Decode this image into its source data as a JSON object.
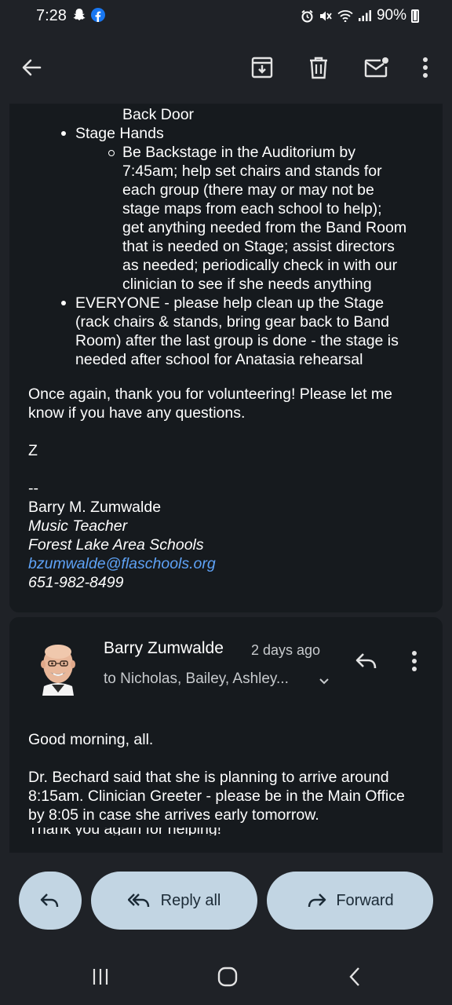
{
  "status_bar": {
    "time": "7:28",
    "battery": "90%"
  },
  "toolbar": {
    "back_icon": "arrow-left-icon",
    "archive_icon": "archive-icon",
    "delete_icon": "trash-icon",
    "mark_unread_icon": "mail-unread-icon",
    "more_icon": "more-vertical-icon"
  },
  "message1": {
    "partial_line": "Back Door",
    "bullets": [
      {
        "label": "Stage Hands",
        "sub": [
          [
            "Be Backstage in the Auditorium by",
            "7:45am; help set chairs and stands for",
            "each group (there may or may not be",
            "stage maps from each school to help);",
            "get anything needed from the Band Room",
            "that is needed on Stage; assist directors",
            "as needed; periodically check in with our",
            "clinician to see if she needs anything"
          ]
        ]
      },
      {
        "lines": [
          "EVERYONE - please help clean up the Stage",
          "(rack chairs & stands, bring gear back to Band",
          "Room) after the last group is done - the stage is",
          "needed after school for Anatasia rehearsal"
        ]
      }
    ],
    "closing_lines": [
      "Once again, thank you for volunteering!  Please let me",
      "know if you have any questions."
    ],
    "initial": "Z",
    "sig_separator": "--",
    "signature": {
      "name": "Barry M. Zumwalde",
      "title": "Music Teacher",
      "org": "Forest Lake Area Schools",
      "email": "bzumwalde@flaschools.org",
      "phone": "651-982-8499"
    }
  },
  "message2": {
    "sender": "Barry Zumwalde",
    "time": "2 days ago",
    "recipients": "to Nicholas, Bailey, Ashley...",
    "greeting": "Good morning, all.",
    "body_lines": [
      "Dr. Bechard said that she is planning to arrive around",
      "8:15am.  Clinician Greeter - please be in the Main Office",
      "by 8:05 in case she arrives early tomorrow."
    ],
    "cut_line": "Thank you again for helping!"
  },
  "actions": {
    "reply_all": "Reply all",
    "forward": "Forward"
  },
  "colors": {
    "background": "#1f2227",
    "card": "#161a1e",
    "pill": "#c2d5e3",
    "link": "#5ea2f6"
  }
}
